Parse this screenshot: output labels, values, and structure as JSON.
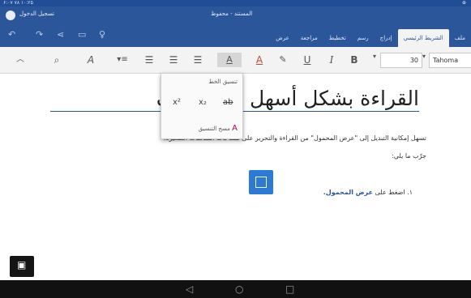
{
  "status": {
    "time": "۶:۰۷ ۷۸ ۱۰:۲۵",
    "icons": "⊕"
  },
  "titlebar": {
    "signin": "تسجيل الدخول",
    "document_name": "المستند - محفوظ"
  },
  "ribbon": {
    "tabs": [
      "ملف",
      "الشريط الرئيسي",
      "إدراج",
      "رسم",
      "تخطيط",
      "مراجعة",
      "عرض"
    ],
    "active_tab": "الشريط الرئيسي"
  },
  "toolbar": {
    "font_name": "Tahoma",
    "font_size": "30",
    "bold": "B",
    "italic": "I",
    "underline": "U",
    "font_color": "A",
    "highlight": "A"
  },
  "font_popup": {
    "header": "تنسيق الخط",
    "superscript": "x²",
    "subscript": "x₂",
    "strikethrough": "ab",
    "clear_formatting": "مسح التنسيق"
  },
  "document": {
    "title": "القراءة بشكل أسهل في الهاتف",
    "paragraph1": "تسهل إمكانية التبديل إلى \"عرض المحمول\" من القراءة والتحرير على مساحات الشاشات الصغيرة.",
    "paragraph2": "جرّب ما يلي:",
    "step_number": "١.",
    "step_text_prefix": "اضغط على ",
    "step_text_bold": "عرض المحمول."
  },
  "nav": {
    "back": "◁",
    "home": "○",
    "recents": "□"
  }
}
